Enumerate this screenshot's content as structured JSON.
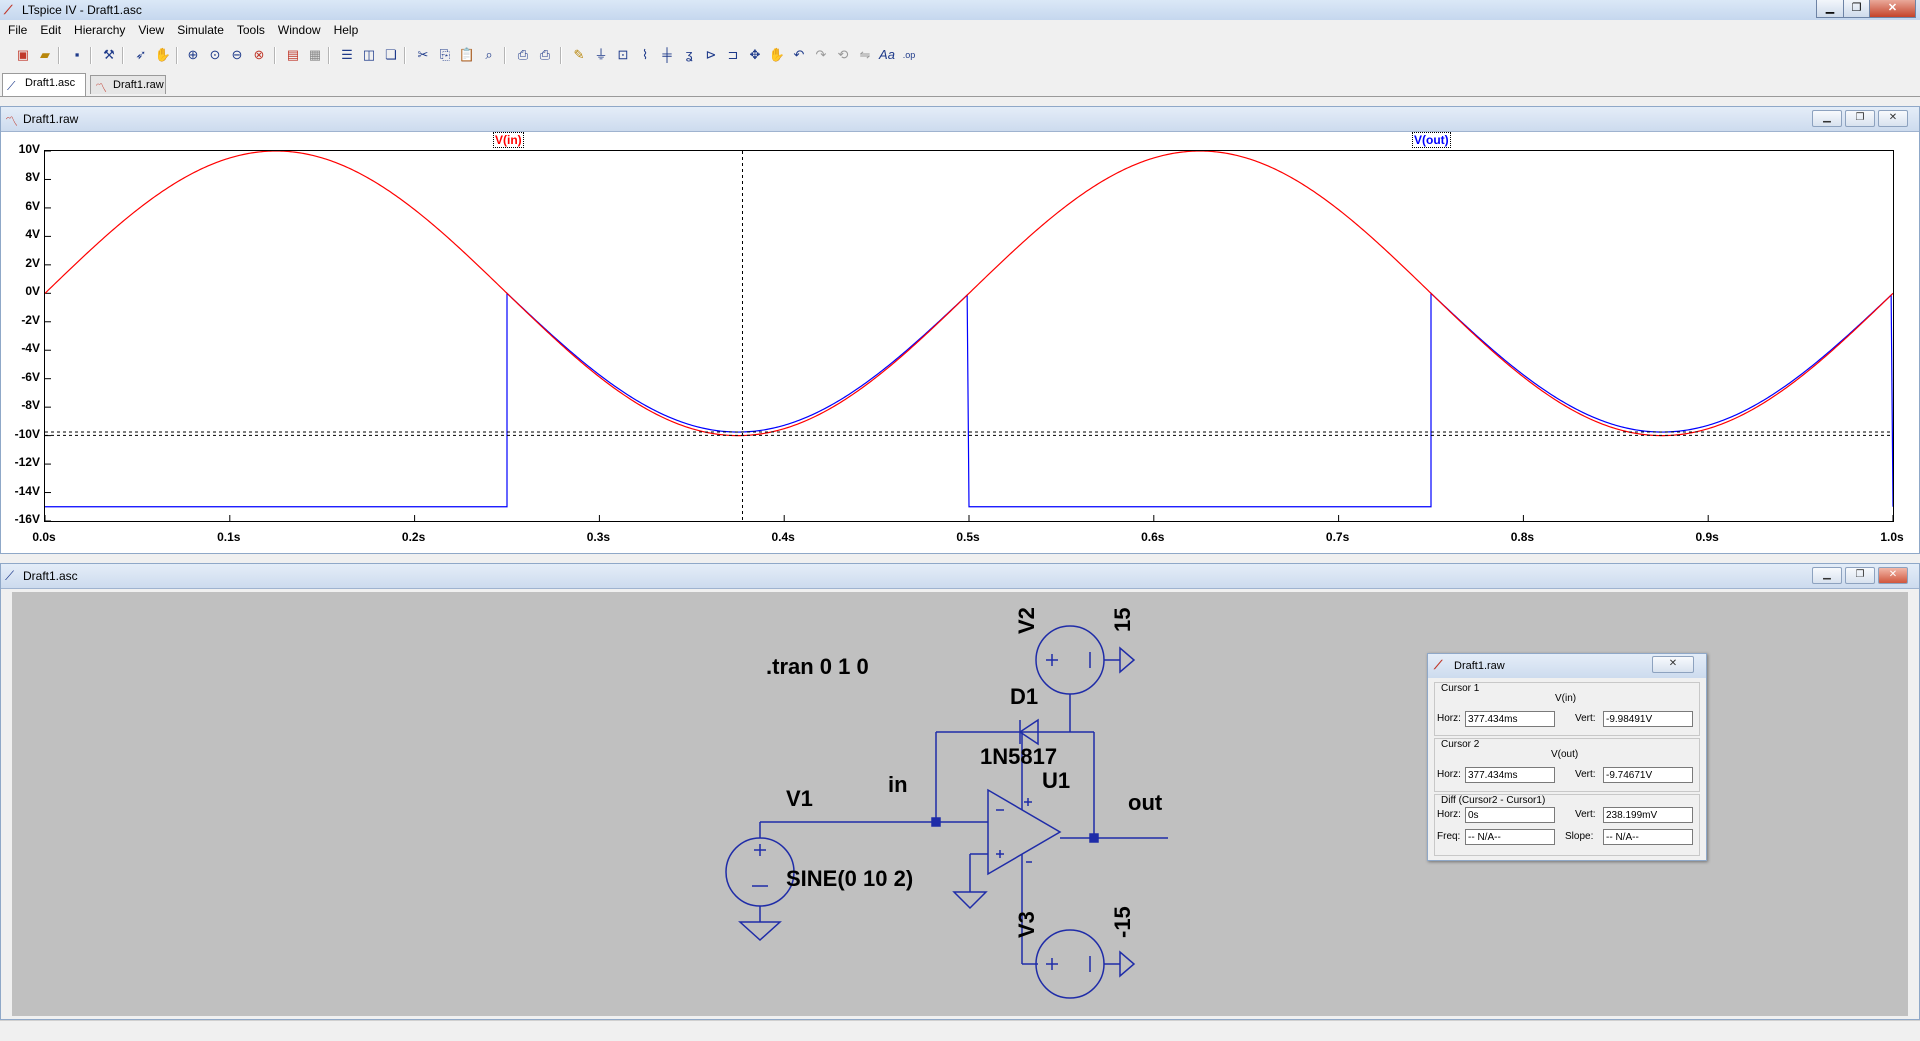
{
  "app": {
    "title": "LTspice IV - Draft1.asc"
  },
  "menu": [
    "File",
    "Edit",
    "Hierarchy",
    "View",
    "Simulate",
    "Tools",
    "Window",
    "Help"
  ],
  "tabs": [
    {
      "label": "Draft1.asc",
      "active": true
    },
    {
      "label": "Draft1.raw",
      "active": false
    }
  ],
  "waveform_window": {
    "title": "Draft1.raw",
    "traces": [
      "V(in)",
      "V(out)"
    ],
    "trace_colors": {
      "V(in)": "#ff0000",
      "V(out)": "#0000ff"
    },
    "y_ticks": [
      "10V",
      "8V",
      "6V",
      "4V",
      "2V",
      "0V",
      "-2V",
      "-4V",
      "-6V",
      "-8V",
      "-10V",
      "-12V",
      "-14V",
      "-16V"
    ],
    "x_ticks": [
      "0.0s",
      "0.1s",
      "0.2s",
      "0.3s",
      "0.4s",
      "0.5s",
      "0.6s",
      "0.7s",
      "0.8s",
      "0.9s",
      "1.0s"
    ]
  },
  "chart_data": {
    "type": "line",
    "x_range": [
      0,
      1.0
    ],
    "y_range": [
      -16,
      10
    ],
    "xlabel": "",
    "ylabel": "",
    "series": [
      {
        "name": "V(in)",
        "color": "#ff0000",
        "formula": "10*sin(2*pi*2*t)",
        "x": [
          0,
          0.125,
          0.25,
          0.375,
          0.5,
          0.625,
          0.75,
          0.875,
          1.0
        ],
        "values": [
          0,
          10,
          0,
          -10,
          0,
          10,
          0,
          -10,
          0
        ]
      },
      {
        "name": "V(out)",
        "color": "#0000ff",
        "x": [
          0,
          0.2499,
          0.2501,
          0.375,
          0.4999,
          0.5001,
          0.7499,
          0.7501,
          0.875,
          1.0
        ],
        "values": [
          -15,
          -15,
          0,
          -9.75,
          0,
          -15,
          -15,
          0,
          -9.75,
          0
        ]
      }
    ],
    "cursors": {
      "x": 0.377434,
      "y1": -9.98491,
      "y2": -9.74671
    }
  },
  "schematic_window": {
    "title": "Draft1.asc",
    "directive": ".tran 0 1 0",
    "labels": {
      "V1": "V1",
      "V2": "V2",
      "V3": "V3",
      "D1": "D1",
      "U1": "U1",
      "diode_model": "1N5817",
      "v1_value": "SINE(0 10 2)",
      "v2_value": "15",
      "v3_value": "-15",
      "net_in": "in",
      "net_out": "out"
    }
  },
  "cursor_dialog": {
    "title": "Draft1.raw",
    "cursor1": {
      "heading": "Cursor 1",
      "trace": "V(in)",
      "horz_label": "Horz:",
      "horz": "377.434ms",
      "vert_label": "Vert:",
      "vert": "-9.98491V"
    },
    "cursor2": {
      "heading": "Cursor 2",
      "trace": "V(out)",
      "horz_label": "Horz:",
      "horz": "377.434ms",
      "vert_label": "Vert:",
      "vert": "-9.74671V"
    },
    "diff": {
      "heading": "Diff (Cursor2 - Cursor1)",
      "horz_label": "Horz:",
      "horz": "0s",
      "vert_label": "Vert:",
      "vert": "238.199mV",
      "freq_label": "Freq:",
      "freq": "-- N/A--",
      "slope_label": "Slope:",
      "slope": "-- N/A--"
    }
  }
}
